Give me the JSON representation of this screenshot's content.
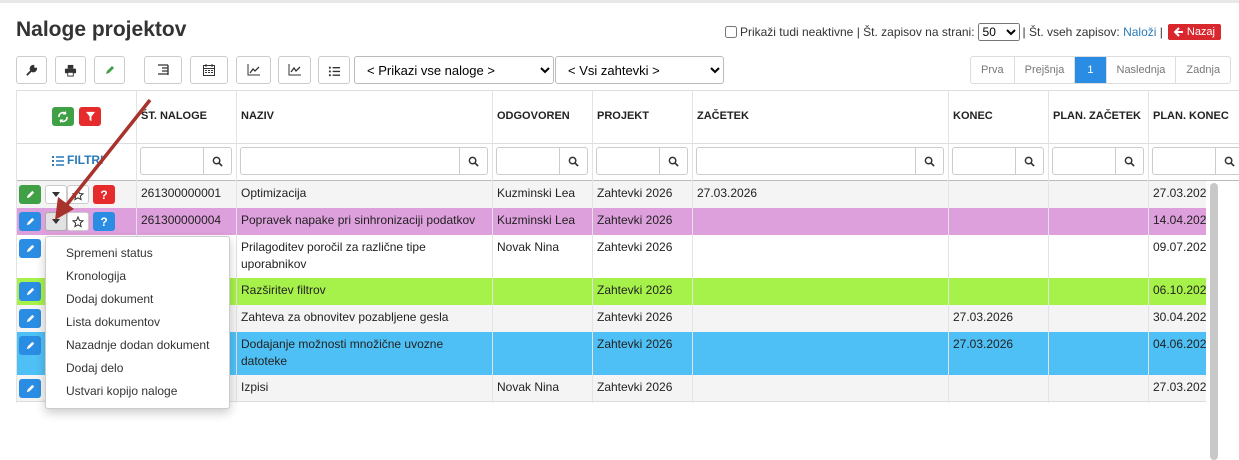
{
  "page": {
    "title": "Naloge projektov"
  },
  "topbar": {
    "show_inactive_label": "Prikaži tudi neaktivne",
    "per_page_label": "Št. zapisov na strani:",
    "per_page_value": "50",
    "total_label": "Št. vseh zapisov:",
    "load_link": "Naloži",
    "back_label": "Nazaj"
  },
  "filters": {
    "tasks_select": "< Prikazi vse naloge >",
    "requests_select": "< Vsi zahtevki >"
  },
  "pager": {
    "first": "Prva",
    "prev": "Prejšnja",
    "current": "1",
    "next": "Naslednja",
    "last": "Zadnja"
  },
  "table": {
    "filter_label": "FILTRI",
    "columns": [
      "ŠT. NALOGE",
      "NAZIV",
      "ODGOVOREN",
      "PROJEKT",
      "ZAČETEK",
      "KONEC",
      "PLAN. ZAČETEK",
      "PLAN. KONEC"
    ],
    "rows": [
      {
        "st": "261300000001",
        "naziv": "Optimizacija",
        "odgovoren": "Kuzminski Lea",
        "projekt": "Zahtevki 2026",
        "zacetek": "27.03.2026",
        "konec": "",
        "plan_zacetek": "",
        "plan_konec": "27.03.202"
      },
      {
        "st": "261300000004",
        "naziv": "Popravek napake pri sinhronizaciji podatkov",
        "odgovoren": "Kuzminski Lea",
        "projekt": "Zahtevki 2026",
        "zacetek": "",
        "konec": "",
        "plan_zacetek": "",
        "plan_konec": "14.04.202"
      },
      {
        "st": "",
        "naziv": "Prilagoditev poročil za različne tipe uporabnikov",
        "odgovoren": "Novak Nina",
        "projekt": "Zahtevki 2026",
        "zacetek": "",
        "konec": "",
        "plan_zacetek": "",
        "plan_konec": "09.07.202"
      },
      {
        "st": "",
        "naziv": "Razširitev filtrov",
        "odgovoren": "",
        "projekt": "Zahtevki 2026",
        "zacetek": "",
        "konec": "",
        "plan_zacetek": "",
        "plan_konec": "06.10.202"
      },
      {
        "st": "",
        "naziv": "Zahteva za obnovitev pozabljene gesla",
        "odgovoren": "",
        "projekt": "Zahtevki 2026",
        "zacetek": "",
        "konec": "27.03.2026",
        "plan_zacetek": "",
        "plan_konec": "30.04.202"
      },
      {
        "st": "",
        "naziv": "Dodajanje možnosti množične uvozne datoteke",
        "odgovoren": "",
        "projekt": "Zahtevki 2026",
        "zacetek": "",
        "konec": "27.03.2026",
        "plan_zacetek": "",
        "plan_konec": "04.06.202"
      },
      {
        "st": "",
        "naziv": "Izpisi",
        "odgovoren": "Novak Nina",
        "projekt": "Zahtevki 2026",
        "zacetek": "",
        "konec": "",
        "plan_zacetek": "",
        "plan_konec": "27.03.202"
      }
    ]
  },
  "dropdown_menu": {
    "items": [
      "Spremeni status",
      "Kronologija",
      "Dodaj dokument",
      "Lista dokumentov",
      "Nazadnje dodan dokument",
      "Dodaj delo",
      "Ustvari kopijo naloge"
    ]
  },
  "colors": {
    "accent": "#2a8de3",
    "row_pink": "#dea0dd",
    "row_green": "#a7f24a",
    "row_blue": "#4fc0f5",
    "back_button": "#d9272e",
    "annotation_arrow": "#a8322c"
  }
}
